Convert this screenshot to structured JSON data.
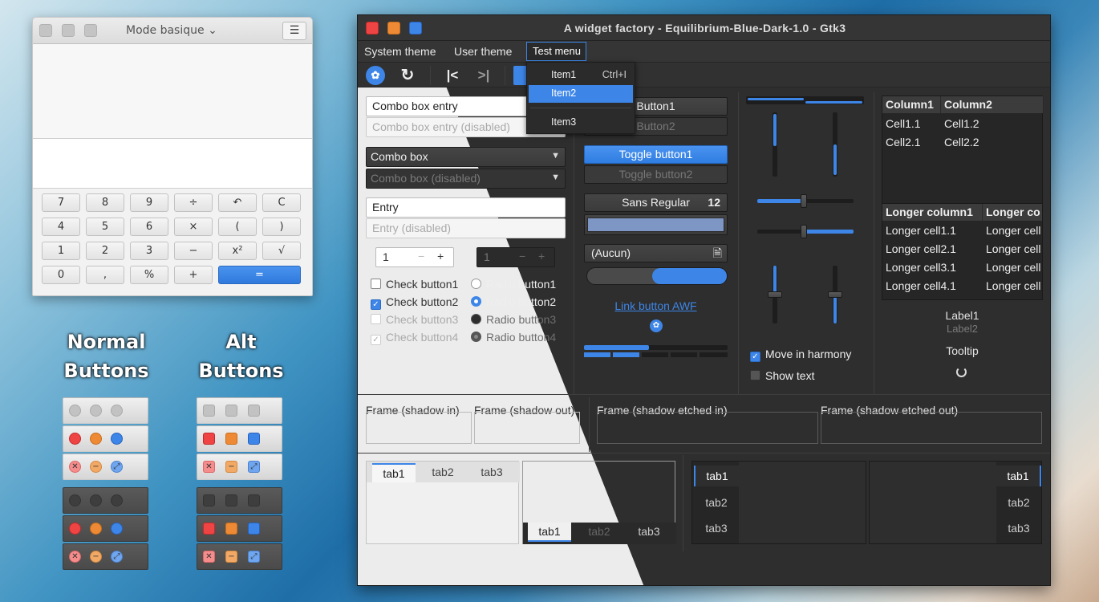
{
  "calculator": {
    "mode_label": "Mode basique",
    "menu_icon": "hamburger-menu-icon",
    "keys": [
      "7",
      "8",
      "9",
      "÷",
      "↶",
      "C",
      "4",
      "5",
      "6",
      "×",
      "(",
      ")",
      "1",
      "2",
      "3",
      "−",
      "x²",
      "√",
      "0",
      ",",
      "%",
      "+",
      "="
    ]
  },
  "captions": {
    "normal_line1": "Normal",
    "normal_line2": "Buttons",
    "alt_line1": "Alt",
    "alt_line2": "Buttons"
  },
  "window": {
    "title": "A widget factory - Equilibrium-Blue-Dark-1.0 - Gtk3",
    "menu": [
      "System theme",
      "User theme",
      "Test menu"
    ],
    "dropdown": {
      "item1": "Item1",
      "item1_accel": "Ctrl+I",
      "item2": "Item2",
      "item3": "Item3"
    },
    "toolbar_icons": [
      "gnome-foot-icon",
      "refresh-icon",
      "goto-first-icon",
      "goto-last-icon"
    ],
    "combo_entry": "Combo box entry",
    "combo_entry_disabled": "Combo box entry (disabled)",
    "combo": "Combo box",
    "combo_disabled": "Combo box (disabled)",
    "entry": "Entry",
    "entry_disabled": "Entry (disabled)",
    "spin_value": "1",
    "spin_disabled_value": "1",
    "checks": [
      "Check button1",
      "Check button2",
      "Check button3",
      "Check button4"
    ],
    "radios": [
      "Radio button1",
      "Radio button2",
      "Radio button3",
      "Radio button4"
    ],
    "button1": "Button1",
    "button2": "Button2",
    "toggle1": "Toggle button1",
    "toggle2": "Toggle button2",
    "font_name": "Sans Regular",
    "font_size": "12",
    "file_chooser": "(Aucun)",
    "link": "Link button AWF",
    "move_harmony": "Move in harmony",
    "show_text": "Show text",
    "tree1": {
      "headers": [
        "Column1",
        "Column2"
      ],
      "rows": [
        [
          "Cell1.1",
          "Cell1.2"
        ],
        [
          "Cell2.1",
          "Cell2.2"
        ]
      ]
    },
    "tree2": {
      "headers": [
        "Longer column1",
        "Longer co"
      ],
      "rows": [
        [
          "Longer cell1.1",
          "Longer cell"
        ],
        [
          "Longer cell2.1",
          "Longer cell"
        ],
        [
          "Longer cell3.1",
          "Longer cell"
        ],
        [
          "Longer cell4.1",
          "Longer cell"
        ]
      ]
    },
    "label1": "Label1",
    "label2": "Label2",
    "tooltip": "Tooltip",
    "frames": [
      "Frame (shadow in)",
      "Frame (shadow out)",
      "Frame (shadow etched in)",
      "Frame (shadow etched out)"
    ],
    "tabs": [
      "tab1",
      "tab2",
      "tab3"
    ],
    "accent": "#3d86e8"
  }
}
